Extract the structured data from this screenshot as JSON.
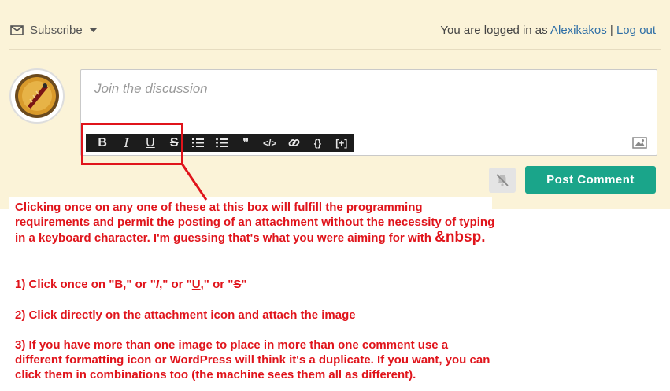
{
  "header": {
    "subscribe_label": "Subscribe",
    "logged_in_prefix": "You are logged in as",
    "username": "Alexikakos",
    "separator": "|",
    "logout_label": "Log out"
  },
  "editor": {
    "placeholder": "Join the discussion",
    "toolbar": {
      "bold": "B",
      "italic": "I",
      "underline": "U",
      "strike": "S",
      "ordered_list": "ordered-list-icon",
      "unordered_list": "unordered-list-icon",
      "quote": "❞",
      "code": "</>",
      "link": "link-icon",
      "code_block": "{}",
      "spoiler": "[+]"
    }
  },
  "actions": {
    "post_label": "Post Comment"
  },
  "annotation": {
    "intro_a": "Clicking once on any one of these at this box will fulfill the programming requirements and permit the posting of an attachment without the necessity of typing in a keyboard character. I'm guessing that's what you were aiming for with ",
    "intro_b": "&nbsp.",
    "step1_a": "1) Click once on \"",
    "step1_b": "B",
    "step1_c": ",\" or \"",
    "step1_d": "I",
    "step1_e": ",\" or \"",
    "step1_f": "U",
    "step1_g": ",\" or \"",
    "step1_h": "S",
    "step1_i": "\"",
    "step2": "2) Click directly on the attachment icon and attach the image",
    "step3": "3) If you have more than one image to place in more than one comment use a different formatting icon or WordPress will think it's a duplicate. If you want, you can click them in combinations too (the machine sees them all as different)."
  },
  "colors": {
    "page_background": "#fbf3d8",
    "post_button": "#1aa58a",
    "link": "#2f6fa6",
    "annotation_red": "#e0141b",
    "toolbar_dark": "#1c1c1c"
  }
}
